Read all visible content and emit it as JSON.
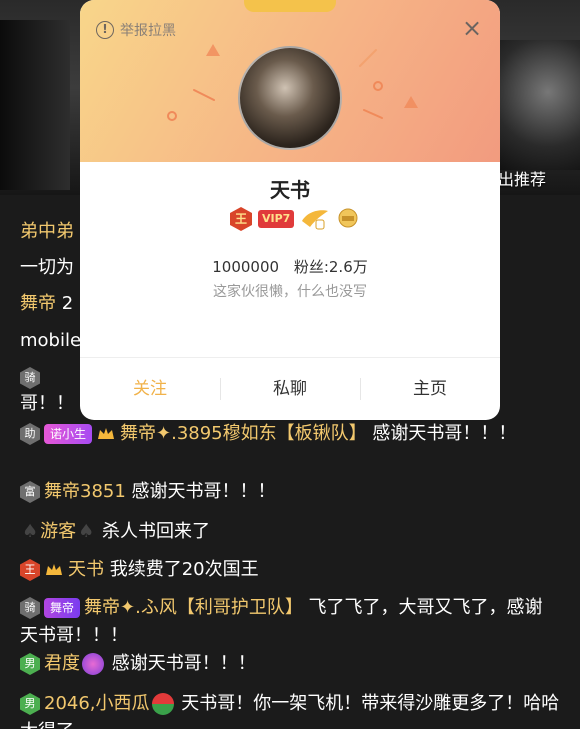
{
  "stage": {
    "recommend_label": "出推荐"
  },
  "card": {
    "report_label": "举报拉黑",
    "close_icon": "×",
    "nickname": "天书",
    "king_badge": "王",
    "vip_badge": "VIP7",
    "user_id": "1000000",
    "fans": "粉丝:2.6万",
    "bio": "这家伙很懒，什么也没写",
    "actions": {
      "follow": "关注",
      "message": "私聊",
      "home": "主页"
    },
    "colors": {
      "header_start": "#f8d68a",
      "header_end": "#f29b7f",
      "follow": "#f1b24a"
    }
  },
  "chat": {
    "partial_lines": [
      {
        "text": "弟中弟"
      },
      {
        "text": "一切为"
      },
      {
        "name": "舞帝",
        "text": "2"
      },
      {
        "text": "mobile"
      }
    ],
    "partial_row": {
      "level": "骑",
      "tail": "哥！！"
    },
    "messages": [
      {
        "level": "助",
        "pill": "诺小生",
        "name": "舞帝✦.3895穆如东【板锹队】",
        "text": " 感谢天书哥！！！"
      },
      {
        "level": "富",
        "name": "舞帝3851",
        "text": " 感谢天书哥！！！"
      },
      {
        "name": "游客",
        "text": "杀人书回来了"
      },
      {
        "level": "王",
        "name": "天书",
        "text": " 我续费了20次国王"
      },
      {
        "level": "骑",
        "pill": "舞帝",
        "name": "舞帝✦.ふ风【利哥护卫队】",
        "text": " 飞了飞了，大哥又飞了，感谢天书哥！！！"
      },
      {
        "level": "男",
        "name": "君度",
        "text": " 感谢天书哥！！！"
      },
      {
        "level": "男",
        "name": "2046,小西瓜",
        "text": " 天书哥！你一架飞机！带来得沙雕更多了！哈哈太得了"
      }
    ]
  }
}
